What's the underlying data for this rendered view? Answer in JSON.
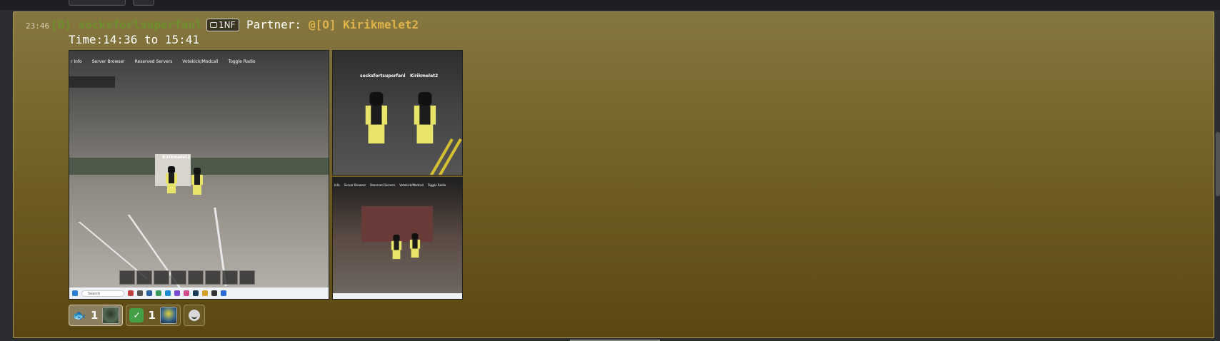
{
  "message": {
    "timestamp": "23:46",
    "author": "[D] socksforlsuperfanl",
    "tag": "1NF",
    "partner_label": "Partner:",
    "partner_name": "@[O] Kirikmelet2",
    "time_line": "Time:14:36 to 15:41"
  },
  "screenshots": {
    "shot1": {
      "menu": [
        "r Info",
        "Server Browser",
        "Reserved Servers",
        "Votekick/Modcall",
        "Toggle Radio"
      ],
      "search_label": "Search",
      "nametag": "Kirikmelet2"
    },
    "shot2": {
      "nametags": [
        "socksfortsuperfanl",
        "Kirikmelet2"
      ]
    },
    "shot3": {
      "menu": [
        "Info",
        "Server Browser",
        "Reserved Servers",
        "Votekick/Modcall",
        "Toggle Radio"
      ]
    }
  },
  "reactions": [
    {
      "emoji": "fish-icon",
      "count": "1",
      "active": true
    },
    {
      "emoji": "check-icon",
      "count": "1",
      "active": false
    }
  ],
  "colors": {
    "author": "#6f8f2c",
    "partner": "#e0b24a",
    "message_bg": "#7a6a30"
  }
}
